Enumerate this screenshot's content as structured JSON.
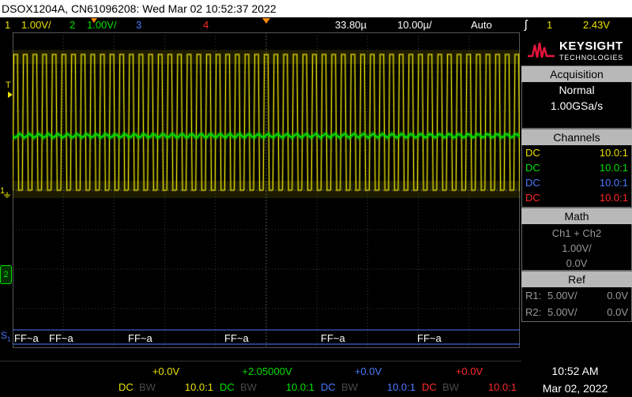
{
  "title": "DSOX1204A, CN61096208: Wed Mar 02 10:52:37 2022",
  "status": {
    "ch1_num": "1",
    "ch1_scale": "1.00V/",
    "ch2_num": "2",
    "ch2_scale": "1.00V/",
    "ch3_num": "3",
    "ch4_num": "4",
    "time_ref": "33.80µ",
    "timebase": "10.00µ/",
    "trigger_mode": "Auto",
    "trig_icon": "ʃ",
    "trig_ch": "1",
    "trig_level": "2.43V"
  },
  "colors": {
    "ch1": "#e8e000",
    "ch2": "#00e000",
    "ch3": "#4a7aff",
    "ch4": "#ff2b2b",
    "header_bg": "#b8b8b8",
    "accent": "#e8143c"
  },
  "markers": {
    "trigger_level": "T",
    "ch1": "1",
    "ch2": "2",
    "serial": "S",
    "serial_sub": "1"
  },
  "logo": {
    "brand": "KEYSIGHT",
    "sub": "TECHNOLOGIES"
  },
  "acquisition": {
    "header": "Acquisition",
    "mode": "Normal",
    "rate": "1.00GSa/s"
  },
  "channels": {
    "header": "Channels",
    "rows": [
      {
        "coupling": "DC",
        "ratio": "10.0:1"
      },
      {
        "coupling": "DC",
        "ratio": "10.0:1"
      },
      {
        "coupling": "DC",
        "ratio": "10.0:1"
      },
      {
        "coupling": "DC",
        "ratio": "10.0:1"
      }
    ]
  },
  "math": {
    "header": "Math",
    "function": "Ch1 + Ch2",
    "scale": "1.00V/",
    "offset": "0.0V"
  },
  "ref": {
    "header": "Ref",
    "rows": [
      {
        "label": "R1:",
        "scale": "5.00V/",
        "offset": "0.0V"
      },
      {
        "label": "R2:",
        "scale": "5.00V/",
        "offset": "0.0V"
      }
    ]
  },
  "decode": {
    "labels": [
      "FF~a",
      "FF~a",
      "FF~a",
      "FF~a",
      "FF~a",
      "FF~a"
    ]
  },
  "footer": {
    "channels": [
      {
        "offset": "+0.0V",
        "coupling": "DC",
        "bw": "BW",
        "ratio": "10.0:1"
      },
      {
        "offset": "+2.05000V",
        "coupling": "DC",
        "bw": "BW",
        "ratio": "10.0:1"
      },
      {
        "offset": "+0.0V",
        "coupling": "DC",
        "bw": "BW",
        "ratio": "10.0:1"
      },
      {
        "offset": "+0.0V",
        "coupling": "DC",
        "bw": "BW",
        "ratio": "10.0:1"
      }
    ],
    "time": "10:52 AM",
    "date": "Mar 02, 2022"
  }
}
